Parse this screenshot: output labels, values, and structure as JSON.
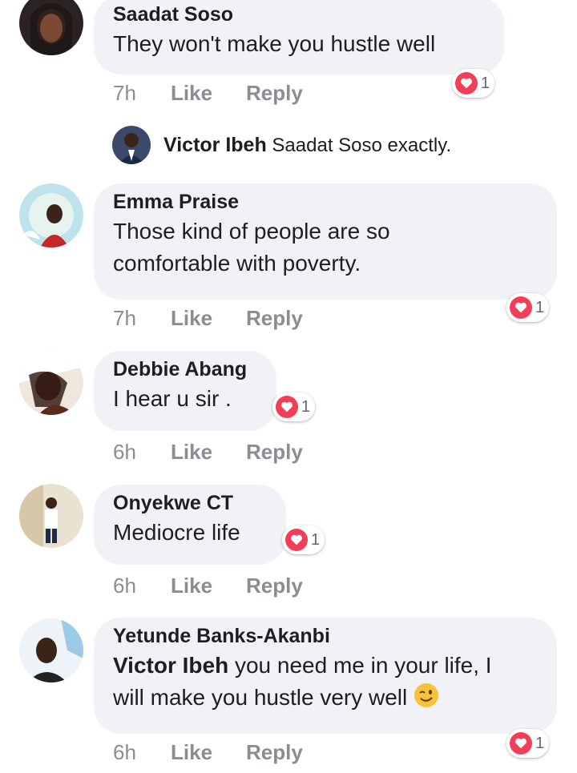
{
  "comments": [
    {
      "name": "Saadat Soso",
      "text": "They won't make you hustle well",
      "time": "7h",
      "like": "Like",
      "reply": "Reply",
      "reactions": "1"
    },
    {
      "name": "Emma Praise",
      "text1": "Those kind of people are so",
      "text2": "comfortable with poverty.",
      "time": "7h",
      "like": "Like",
      "reply": "Reply",
      "reactions": "1"
    },
    {
      "name": "Debbie Abang",
      "text": "I hear u sir .",
      "time": "6h",
      "like": "Like",
      "reply": "Reply",
      "reactions": "1"
    },
    {
      "name": "Onyekwe CT",
      "text": "Mediocre life",
      "time": "6h",
      "like": "Like",
      "reply": "Reply",
      "reactions": "1"
    },
    {
      "name": "Yetunde Banks-Akanbi",
      "mention": "Victor Ibeh",
      "text1": " you need me in your life, I",
      "text2": "will make you hustle very well",
      "emoji": "winking-face-emoji",
      "time": "6h",
      "like": "Like",
      "reply": "Reply",
      "reactions": "1"
    }
  ],
  "nested_reply": {
    "name": "Victor Ibeh",
    "mention": "Saadat Soso",
    "text": "exactly."
  },
  "colors": {
    "bubble": "#f0f2f5",
    "meta": "#8a8d91",
    "heart": "#f33e58"
  }
}
